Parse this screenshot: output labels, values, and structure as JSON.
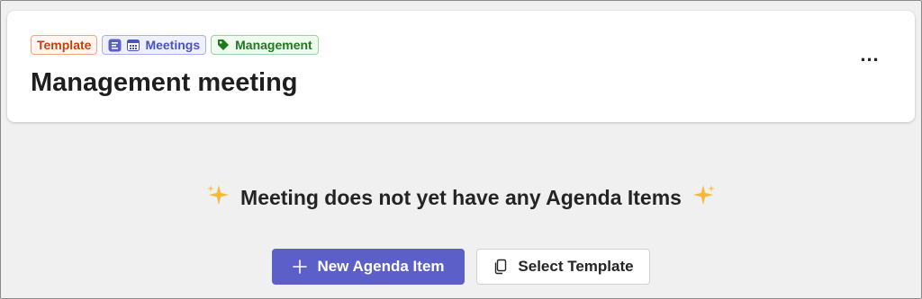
{
  "header": {
    "tags": {
      "template": "Template",
      "meetings": "Meetings",
      "management": "Management"
    },
    "title": "Management meeting",
    "more_label": "..."
  },
  "empty_state": {
    "message": "Meeting does not yet have any Agenda Items"
  },
  "actions": {
    "new_item_label": "New Agenda Item",
    "select_template_label": "Select Template"
  },
  "colors": {
    "primary": "#5b5fc7",
    "template_tag": "#c43f0b",
    "meetings_tag": "#4b53bc",
    "management_tag": "#1f7a1f",
    "sparkle": "#f2b132"
  },
  "icons": {
    "meetings_app": "meetings-app-icon",
    "calendar": "calendar-icon",
    "tag": "tag-icon",
    "sparkle": "sparkle-icon",
    "plus": "plus-icon",
    "copy": "copy-icon"
  }
}
